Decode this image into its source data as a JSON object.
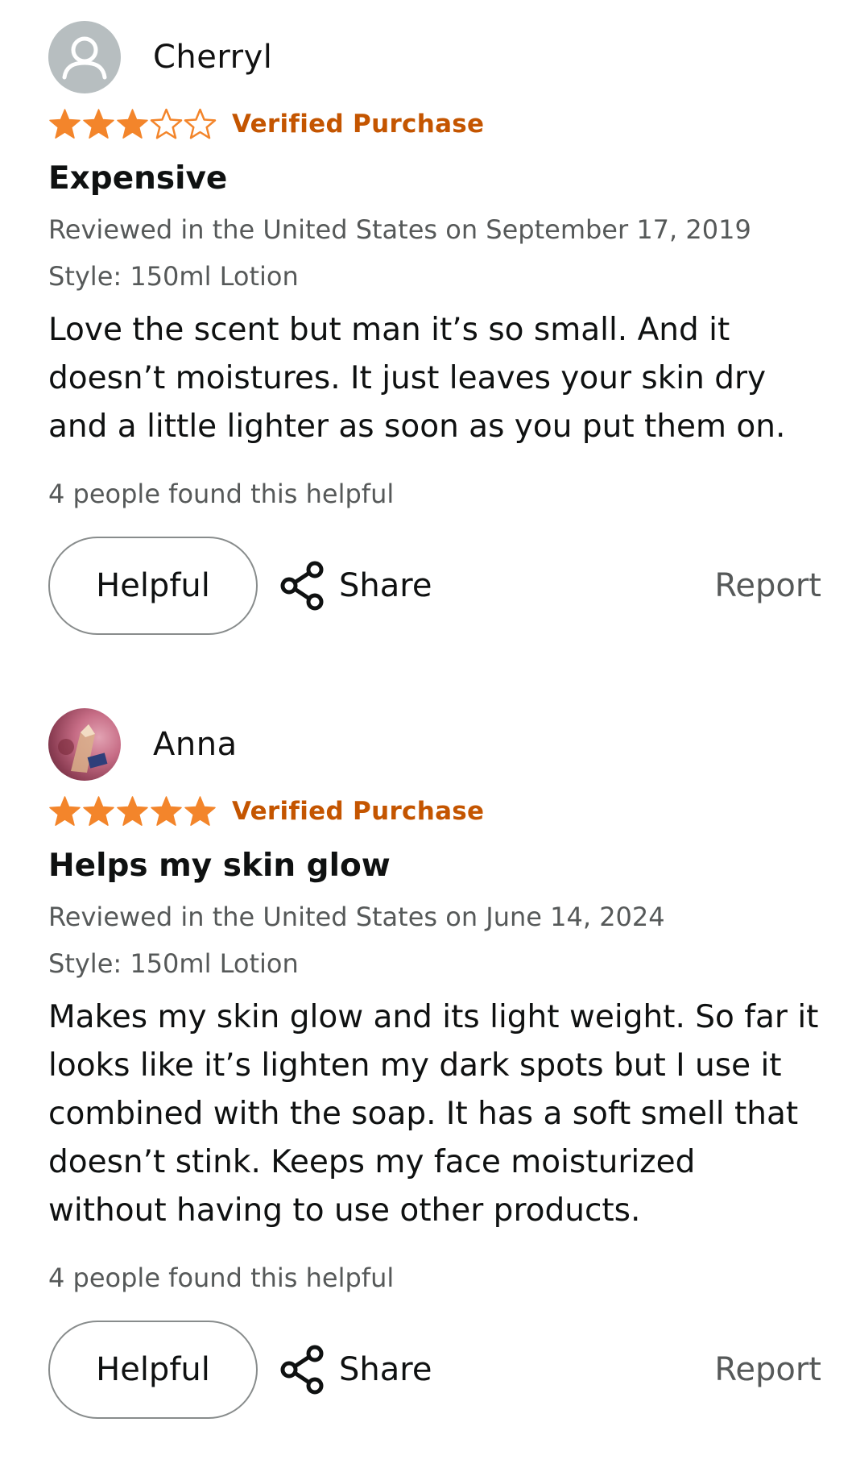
{
  "colors": {
    "star_fill": "#f3852b",
    "verified": "#c45500",
    "meta_text": "#565959"
  },
  "reviews": [
    {
      "name": "Cherryl",
      "avatar": "default-user-icon",
      "rating": 3,
      "max_rating": 5,
      "verified": "Verified Purchase",
      "title": "Expensive",
      "meta": "Reviewed in the United States on September 17, 2019",
      "style": "Style: 150ml Lotion",
      "body": "Love the scent but man it’s so small. And it doesn’t moistures. It just leaves your skin dry and a little lighter as soon as you put them on.",
      "helpful_count": "4 people found this helpful",
      "helpful_label": "Helpful",
      "share_label": "Share",
      "report_label": "Report"
    },
    {
      "name": "Anna",
      "avatar": "user-photo",
      "rating": 5,
      "max_rating": 5,
      "verified": "Verified Purchase",
      "title": "Helps my skin glow",
      "meta": "Reviewed in the United States on June 14, 2024",
      "style": "Style: 150ml Lotion",
      "body": "Makes my skin glow and its light weight. So far it looks like it’s lighten my dark spots but I use it combined with the soap. It has a soft smell that doesn’t stink. Keeps my face moisturized without having to use other products.",
      "helpful_count": "4 people found this helpful",
      "helpful_label": "Helpful",
      "share_label": "Share",
      "report_label": "Report"
    }
  ]
}
